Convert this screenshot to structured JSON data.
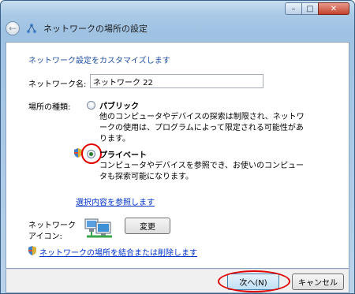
{
  "window": {
    "title": "ネットワークの場所の設定",
    "controls": {
      "minimize": "–",
      "maximize": "□",
      "close": "✕"
    }
  },
  "content": {
    "heading": "ネットワーク設定をカスタマイズします",
    "network_name_label": "ネットワーク名:",
    "network_name_value": "ネットワーク 22",
    "location_type_label": "場所の種類:",
    "options": [
      {
        "title": "パブリック",
        "description": "他のコンピュータやデバイスの探索は制限され、ネットワークの使用は、プログラムによって限定される可能性があります。",
        "selected": false
      },
      {
        "title": "プライベート",
        "description": "コンピュータやデバイスを参照でき、お使いのコンピュータも探索可能になります。",
        "selected": true
      }
    ],
    "help_link": "選択内容を参照します",
    "network_icon_label_line1": "ネットワーク",
    "network_icon_label_line2": "アイコン:",
    "change_button": "変更",
    "merge_link": "ネットワークの場所を結合または削除します"
  },
  "footer": {
    "next_button": "次へ(N)",
    "cancel_button": "キャンセル"
  },
  "colors": {
    "heading": "#1f4fa3",
    "link": "#0033cc",
    "highlight": "#e00000"
  }
}
